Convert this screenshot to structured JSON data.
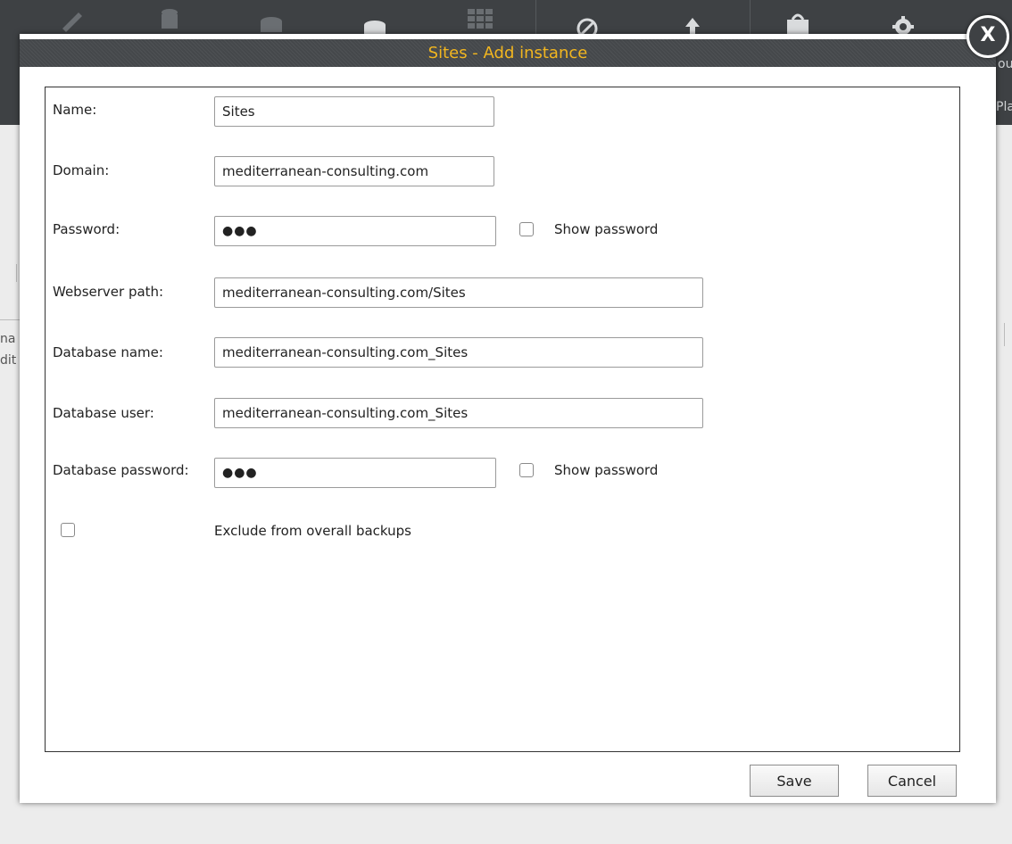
{
  "background": {
    "toolbar_fragment_top": "ou",
    "toolbar_fragment_bottom": "Pla",
    "left_fragment_1": "na",
    "left_fragment_2": "dit",
    "icons": [
      "pencil-icon",
      "trash-database-icon",
      "database-icon",
      "database-stack-icon",
      "grid-icon",
      "disabled-icon",
      "upload-icon",
      "basket-icon",
      "gear-icon"
    ]
  },
  "dialog": {
    "title": "Sites - Add instance",
    "close_label": "X",
    "fields": {
      "name": {
        "label": "Name:",
        "value": "Sites"
      },
      "domain": {
        "label": "Domain:",
        "value": "mediterranean-consulting.com"
      },
      "password": {
        "label": "Password:",
        "value": "●●●",
        "show_label": "Show password"
      },
      "webserver_path": {
        "label": "Webserver path:",
        "value": "mediterranean-consulting.com/Sites"
      },
      "database_name": {
        "label": "Database name:",
        "value": "mediterranean-consulting.com_Sites"
      },
      "database_user": {
        "label": "Database user:",
        "value": "mediterranean-consulting.com_Sites"
      },
      "database_password": {
        "label": "Database password:",
        "value": "●●●",
        "show_label": "Show password"
      }
    },
    "exclude_label": "Exclude from overall backups",
    "save_label": "Save",
    "cancel_label": "Cancel"
  },
  "colors": {
    "title_text": "#f2b61f",
    "title_bar": "#45484b",
    "toolbar": "#3e4144"
  }
}
